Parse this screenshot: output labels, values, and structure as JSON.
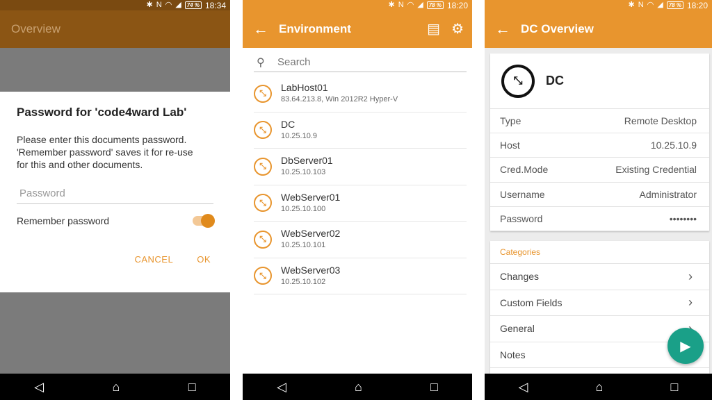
{
  "status": {
    "screen1": {
      "battery": "74 %",
      "time": "18:34"
    },
    "screen2": {
      "battery": "78 %",
      "time": "18:20"
    },
    "screen3": {
      "battery": "78 %",
      "time": "18:20"
    }
  },
  "screen1": {
    "title": "Overview",
    "dialog": {
      "title": "Password for 'code4ward Lab'",
      "message": "Please enter this documents password.\n'Remember password' saves it for re-use\nfor this and other documents.",
      "password_placeholder": "Password",
      "remember_label": "Remember password",
      "remember_checked": true,
      "cancel": "CANCEL",
      "ok": "OK"
    }
  },
  "screen2": {
    "title": "Environment",
    "search_placeholder": "Search",
    "items": [
      {
        "name": "LabHost01",
        "detail": "83.64.213.8, Win 2012R2 Hyper-V"
      },
      {
        "name": "DC",
        "detail": "10.25.10.9"
      },
      {
        "name": "DbServer01",
        "detail": "10.25.10.103"
      },
      {
        "name": "WebServer01",
        "detail": "10.25.10.100"
      },
      {
        "name": "WebServer02",
        "detail": "10.25.10.101"
      },
      {
        "name": "WebServer03",
        "detail": "10.25.10.102"
      }
    ]
  },
  "screen3": {
    "title": "DC Overview",
    "name": "DC",
    "properties": [
      {
        "key": "Type",
        "value": "Remote Desktop"
      },
      {
        "key": "Host",
        "value": "10.25.10.9"
      },
      {
        "key": "Cred.Mode",
        "value": "Existing Credential"
      },
      {
        "key": "Username",
        "value": "Administrator"
      },
      {
        "key": "Password",
        "value": "••••••••"
      }
    ],
    "categories_header": "Categories",
    "categories": [
      "Changes",
      "Custom Fields",
      "General",
      "Notes"
    ]
  },
  "colors": {
    "accent": "#e8952e",
    "fab": "#1aa088"
  },
  "icons": {
    "back": "back-arrow-icon",
    "list": "list-icon",
    "settings": "gear-icon",
    "search": "search-icon",
    "rdp": "remote-desktop-icon",
    "play": "play-icon"
  }
}
